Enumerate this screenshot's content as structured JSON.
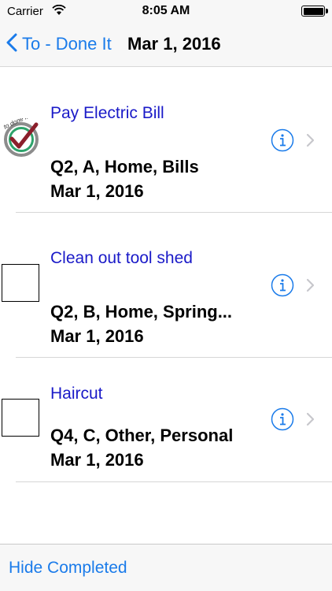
{
  "status_bar": {
    "carrier": "Carrier",
    "time": "8:05 AM",
    "wifi_icon": "wifi-icon",
    "battery_level": 1.0
  },
  "nav": {
    "back_label": "To - Done It",
    "title": "Mar 1, 2016"
  },
  "tasks": [
    {
      "title": "Pay Electric Bill",
      "meta": "Q2, A, Home, Bills",
      "date": "Mar 1, 2016",
      "completed": true,
      "logo_text": "to done it!"
    },
    {
      "title": "Clean out tool shed",
      "meta": "Q2, B, Home, Spring...",
      "date": "Mar 1, 2016",
      "completed": false
    },
    {
      "title": "Haircut",
      "meta": "Q4, C, Other, Personal",
      "date": "Mar 1, 2016",
      "completed": false
    }
  ],
  "toolbar": {
    "hide_completed_label": "Hide Completed"
  },
  "colors": {
    "accent": "#1a7bea",
    "title_text": "#1a1ac8",
    "logo_green": "#2ea36b",
    "logo_check": "#8b1f2b"
  }
}
